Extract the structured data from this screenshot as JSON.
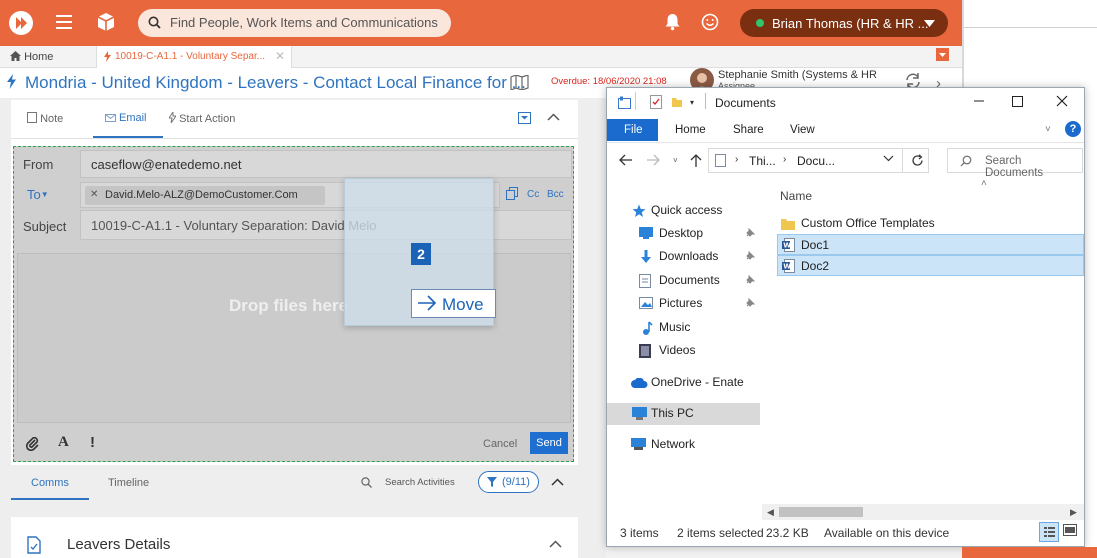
{
  "topbar": {
    "search_placeholder": "Find People, Work Items and Communications",
    "user_name": "Brian Thomas (HR & HR ...",
    "colors": {
      "bar": "#e8673d",
      "pill": "#7a2f10",
      "status": "#33c36b"
    }
  },
  "tabs": {
    "home": "Home",
    "active": "10019-C-A1.1 - Voluntary Separ..."
  },
  "work_item": {
    "title": "Mondria - United Kingdom - Leavers - Contact Local Finance for ...",
    "overdue": "Overdue: 18/06/2020 21:08",
    "assignee": "Stephanie Smith (Systems & HR",
    "assignee_sub": "Assignee"
  },
  "action_tabs": {
    "note": "Note",
    "email": "Email",
    "start_action": "Start Action"
  },
  "email": {
    "from_label": "From",
    "from_value": "caseflow@enatedemo.net",
    "to_label": "To",
    "to_recipient": "David.Melo-ALZ@DemoCustomer.Com",
    "cc": "Cc",
    "bcc": "Bcc",
    "subject_label": "Subject",
    "subject_value": "10019-C-A1.1 - Voluntary Separation: David Melo",
    "drop_text": "Drop files here",
    "cancel": "Cancel",
    "send": "Send"
  },
  "drag": {
    "count": "2",
    "action": "Move"
  },
  "bottom_tabs": {
    "comms": "Comms",
    "timeline": "Timeline",
    "search_activities": "Search Activities",
    "filter_count": "(9/11)"
  },
  "section": {
    "title": "Leavers Details"
  },
  "explorer": {
    "title": "Documents",
    "ribbon": [
      "File",
      "Home",
      "Share",
      "View"
    ],
    "path_1": "Thi...",
    "path_2": "Docu...",
    "search_placeholder": "Search Documents",
    "column_name": "Name",
    "nav": {
      "quick_access": "Quick access",
      "desktop": "Desktop",
      "downloads": "Downloads",
      "documents": "Documents",
      "pictures": "Pictures",
      "music": "Music",
      "videos": "Videos",
      "onedrive": "OneDrive - Enate",
      "this_pc": "This PC",
      "network": "Network"
    },
    "files": [
      "Custom Office Templates",
      "Doc1",
      "Doc2"
    ],
    "status": {
      "items": "3 items",
      "selected": "2 items selected",
      "size": "23.2 KB",
      "availability": "Available on this device"
    }
  }
}
